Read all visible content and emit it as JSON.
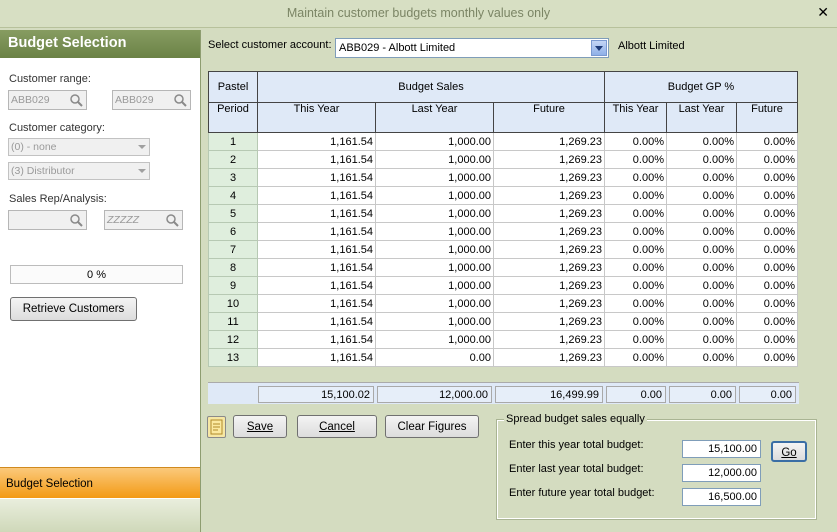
{
  "window": {
    "title": "Maintain customer budgets monthly values only",
    "close_label": "✕"
  },
  "sidebar": {
    "header": "Budget Selection",
    "customer_range_label": "Customer range:",
    "range_from": "ABB029",
    "range_to": "ABB029",
    "category_label": "Customer category:",
    "category_1": "(0) - none",
    "category_2": "(3) Distributor",
    "sales_rep_label": "Sales Rep/Analysis:",
    "sales_rep_from": "",
    "sales_rep_to": "ZZZZZ",
    "progress": "0 %",
    "progress_value": 0,
    "retrieve_button": "Retrieve Customers",
    "nav_item": "Budget Selection"
  },
  "main": {
    "select_label": "Select customer account:",
    "account_value": "ABB029 - Albott Limited",
    "account_name": "Albott Limited",
    "headers": {
      "pastel": "Pastel",
      "period": "Period",
      "budget_sales": "Budget Sales",
      "budget_gp": "Budget GP %",
      "this_year": "This Year",
      "last_year": "Last Year",
      "future": "Future",
      "gp_this_year": "This Year",
      "gp_last_year": "Last Year",
      "gp_future": "Future"
    },
    "rows": [
      [
        "1",
        "1,161.54",
        "1,000.00",
        "1,269.23",
        "0.00%",
        "0.00%",
        "0.00%"
      ],
      [
        "2",
        "1,161.54",
        "1,000.00",
        "1,269.23",
        "0.00%",
        "0.00%",
        "0.00%"
      ],
      [
        "3",
        "1,161.54",
        "1,000.00",
        "1,269.23",
        "0.00%",
        "0.00%",
        "0.00%"
      ],
      [
        "4",
        "1,161.54",
        "1,000.00",
        "1,269.23",
        "0.00%",
        "0.00%",
        "0.00%"
      ],
      [
        "5",
        "1,161.54",
        "1,000.00",
        "1,269.23",
        "0.00%",
        "0.00%",
        "0.00%"
      ],
      [
        "6",
        "1,161.54",
        "1,000.00",
        "1,269.23",
        "0.00%",
        "0.00%",
        "0.00%"
      ],
      [
        "7",
        "1,161.54",
        "1,000.00",
        "1,269.23",
        "0.00%",
        "0.00%",
        "0.00%"
      ],
      [
        "8",
        "1,161.54",
        "1,000.00",
        "1,269.23",
        "0.00%",
        "0.00%",
        "0.00%"
      ],
      [
        "9",
        "1,161.54",
        "1,000.00",
        "1,269.23",
        "0.00%",
        "0.00%",
        "0.00%"
      ],
      [
        "10",
        "1,161.54",
        "1,000.00",
        "1,269.23",
        "0.00%",
        "0.00%",
        "0.00%"
      ],
      [
        "11",
        "1,161.54",
        "1,000.00",
        "1,269.23",
        "0.00%",
        "0.00%",
        "0.00%"
      ],
      [
        "12",
        "1,161.54",
        "1,000.00",
        "1,269.23",
        "0.00%",
        "0.00%",
        "0.00%"
      ],
      [
        "13",
        "1,161.54",
        "0.00",
        "1,269.23",
        "0.00%",
        "0.00%",
        "0.00%"
      ]
    ],
    "totals": [
      "15,100.02",
      "12,000.00",
      "16,499.99",
      "0.00",
      "0.00",
      "0.00"
    ],
    "buttons": {
      "save": "Save",
      "cancel": "Cancel",
      "clear": "Clear Figures"
    },
    "spread": {
      "title": "Spread budget sales equally",
      "this_year_label": "Enter this year total budget:",
      "this_year_value": "15,100.00",
      "last_year_label": "Enter last year total budget:",
      "last_year_value": "12,000.00",
      "future_label": "Enter future year total budget:",
      "future_value": "16,500.00",
      "go": "Go"
    }
  },
  "colors": {
    "sidebar_header": "#6b8246",
    "nav_active": "#f39a14",
    "period_cell": "#dfeedd",
    "grid_header": "#dfe9f7"
  }
}
